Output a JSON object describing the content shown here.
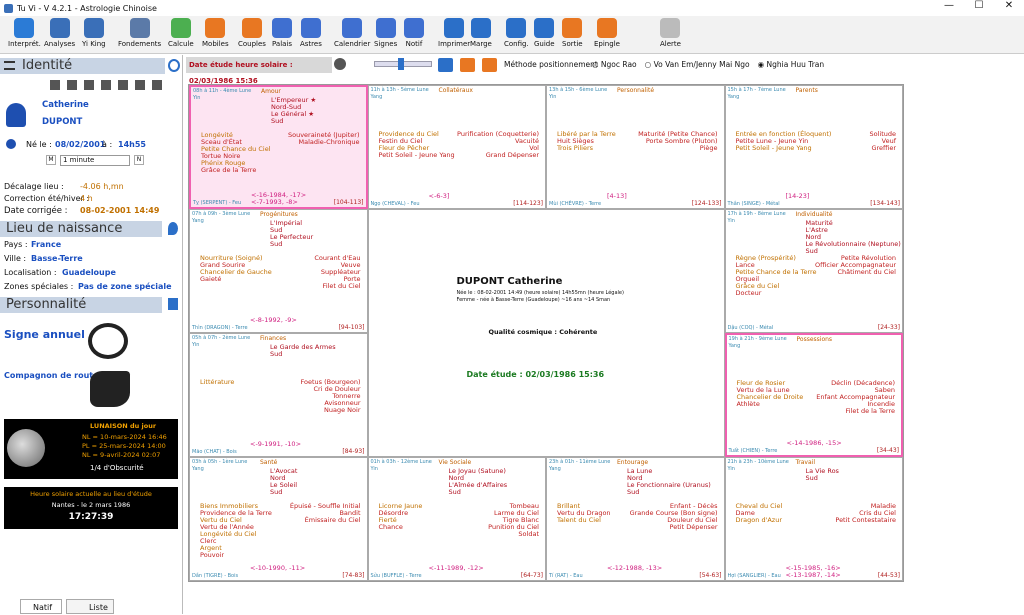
{
  "window": {
    "title": "Tu Vi - V 4.2.1 - Astrologie Chinoise",
    "min": "—",
    "max": "☐",
    "close": "✕"
  },
  "toolbar": [
    {
      "label": "Interprét.",
      "color": "#2b7bd6"
    },
    {
      "label": "Analyses",
      "color": "#3a6fb8"
    },
    {
      "label": "Yi King",
      "color": "#3a6fb8"
    },
    {
      "label": "Fondements",
      "color": "#5b7aa8"
    },
    {
      "label": "Calcule",
      "color": "#4caf50"
    },
    {
      "label": "Mobiles",
      "color": "#e87722"
    },
    {
      "label": "Couples",
      "color": "#e87722"
    },
    {
      "label": "Palais",
      "color": "#3f6fd0"
    },
    {
      "label": "Astres",
      "color": "#3f6fd0"
    },
    {
      "label": "Calendrier",
      "color": "#3f6fd0"
    },
    {
      "label": "Signes",
      "color": "#3f6fd0"
    },
    {
      "label": "Notif",
      "color": "#3f6fd0"
    },
    {
      "label": "Imprimer",
      "color": "#2b6fc8"
    },
    {
      "label": "Marge",
      "color": "#2b6fc8"
    },
    {
      "label": "Config.",
      "color": "#2b6fc8"
    },
    {
      "label": "Guide",
      "color": "#2b6fc8"
    },
    {
      "label": "Sortie",
      "color": "#e87722"
    },
    {
      "label": "Epingle",
      "color": "#e87722"
    },
    {
      "label": "Alerte",
      "color": "#bbbbbb"
    }
  ],
  "subbar": {
    "date_label": "Date étude heure solaire : 02/03/1986 15:36",
    "method_label": "Méthode positionnement",
    "options": [
      "Ngoc Rao",
      "Vo Van Em/Jenny Mai Ngo",
      "Nghia Huu Tran"
    ],
    "selected": 2
  },
  "identity": {
    "section": "Identité",
    "first_name": "Catherine",
    "last_name": "DUPONT",
    "born_label": "Né le :",
    "birth_date": "08/02/2001",
    "at_label": "à :",
    "birth_time": "14h55",
    "interval": "1 minute"
  },
  "corrections": {
    "lieu_label": "Décalage lieu :",
    "lieu_val": "-4.06 h,mn",
    "ete_label": "Correction été/hiver :",
    "ete_val": "4 h",
    "date_label": "Date corrigée :",
    "date_val": "08-02-2001  14:49"
  },
  "birthplace": {
    "section": "Lieu de naissance",
    "country_label": "Pays :",
    "country": "France",
    "city_label": "Ville :",
    "city": "Basse-Terre",
    "loc_label": "Localisation :",
    "loc": "Guadeloupe",
    "zones_label": "Zones spéciales :",
    "zones": "Pas de zone spéciale"
  },
  "personality": {
    "section": "Personnalité",
    "sign_label": "Signe annuel",
    "companion_label": "Compagnon de route"
  },
  "lunaison": {
    "title": "LUNAISON du jour",
    "nl": "NL = 10-mars-2024 16:46",
    "pl": "PL = 25-mars-2024 14:00",
    "nl2": "NL = 9-avril-2024 02:07",
    "obscurity": "1/4 d'Obscurité"
  },
  "solar": {
    "title": "Heure solaire actuelle au lieu d'étude",
    "place": "Nantes - le 2 mars 1986",
    "time": "17:27:39"
  },
  "tabs": {
    "natif": "Natif",
    "liste": "Liste"
  },
  "center": {
    "name": "DUPONT Catherine",
    "info1": "Née le : 08-02-2001  14:49 (heure solaire) 14h55mn (heure Légale)",
    "info2": "Femme - née à Basse-Terre (Guadeloupe) ~16 ans ~14 Sman",
    "quality": "Qualité cosmique : Cohérente",
    "date_etude": "Date étude : 02/03/1986 15:36"
  },
  "palaces": [
    {
      "id": "p1",
      "head": "08h à 11h - 4ème Lune",
      "yy": "Yin",
      "name": "Amour",
      "foot": "Tỵ (SERPENT) - Feu",
      "range": "[104-113]",
      "age": "<-16-1984, -17>",
      "age2": "<-7-1993, -8>",
      "left": [
        "Longévité",
        "Sceau d'État",
        "Petite Chance du Ciel",
        "Tortue Noire",
        "Phénix Rouge",
        "Grâce de la Terre"
      ],
      "right": [
        "Souveraineté (Jupiter)",
        "Maladie-Chronique"
      ],
      "stars": [
        "L'Empereur ★",
        "Nord-Sud",
        "Le Général ★",
        "Sud"
      ]
    },
    {
      "id": "p2",
      "head": "11h à 13h - 5ème Lune",
      "yy": "Yang",
      "name": "Collatéraux",
      "foot": "Ngọ (CHEVAL) - Feu",
      "range": "[114-123]",
      "age": "<-6-3]",
      "age2": "",
      "left": [
        "Providence du Ciel",
        "Festin du Ciel",
        "Fleur de Pêcher",
        "Petit Soleil - Jeune Yang"
      ],
      "right": [
        "Purification (Coquetterie)",
        "Vacuité",
        "Vol",
        "Grand Dépenser"
      ],
      "stars": []
    },
    {
      "id": "p3",
      "head": "13h à 15h - 6ème Lune",
      "yy": "Yin",
      "name": "Personnalité",
      "foot": "Mùi (CHÈVRE) - Terre",
      "range": "[124-133]",
      "age": "[4-13]",
      "age2": "",
      "left": [
        "Libéré par la Terre",
        "Huit Sièges",
        "Trois Piliers"
      ],
      "right": [
        "Maturité (Petite Chance)",
        "Porte Sombre (Pluton)",
        "Piège"
      ],
      "stars": []
    },
    {
      "id": "p4",
      "head": "15h à 17h - 7ème Lune",
      "yy": "Yang",
      "name": "Parents",
      "foot": "Thân (SINGE) - Métal",
      "range": "[134-143]",
      "age": "[14-23]",
      "age2": "",
      "left": [
        "Entrée en fonction (Éloquent)",
        "Petite Lune - Jeune Yin",
        "Petit Soleil - Jeune Yang"
      ],
      "right": [
        "Solitude",
        "Veuf",
        "Greffier"
      ],
      "stars": []
    },
    {
      "id": "p5",
      "head": "07h à 09h - 3ème Lune",
      "yy": "Yang",
      "name": "Progénitures",
      "foot": "Thìn (DRAGON) - Terre",
      "range": "[94-103]",
      "age": "<-8-1992, -9>",
      "age2": "",
      "left": [
        "Nourriture (Soigné)",
        "Grand Sourire",
        "Chancelier de Gauche",
        "Gaieté"
      ],
      "right": [
        "Courant d'Eau",
        "Veuve",
        "Suppléateur",
        "Porte",
        "Filet du Ciel"
      ],
      "stars": [
        "L'Impérial",
        "Sud",
        "Le Perfecteur",
        "Sud"
      ]
    },
    {
      "id": "p6",
      "head": "17h à 19h - 8ème Lune",
      "yy": "Yin",
      "name": "Individualité",
      "foot": "Dậu (COQ) - Métal",
      "range": "[24-33]",
      "age": "",
      "age2": "",
      "left": [
        "Règne (Prospérité)",
        "Lance",
        "Petite Chance de la Terre",
        "Orgueil",
        "Grâce du Ciel",
        "Docteur"
      ],
      "right": [
        "Petite Révolution",
        "Officier Accompagnateur",
        "Châtiment du Ciel"
      ],
      "stars": [
        "Maturité",
        "L'Astre",
        "Nord",
        "Le Révolutionnaire (Neptune)",
        "Sud"
      ]
    },
    {
      "id": "p7",
      "head": "05h à 07h - 2ème Lune",
      "yy": "Yin",
      "name": "Finances",
      "foot": "Mão (CHAT) - Bois",
      "range": "[84-93]",
      "age": "<-9-1991, -10>",
      "age2": "",
      "left": [
        "Littérature"
      ],
      "right": [
        "Foetus (Bourgeon)",
        "Cri de Douleur",
        "Tonnerre",
        "Avisonneur",
        "Nuage Noir"
      ],
      "stars": [
        "Le Garde des Armes",
        "Sud"
      ]
    },
    {
      "id": "p8",
      "head": "19h à 21h - 9ème Lune",
      "yy": "Yang",
      "name": "Possessions",
      "foot": "Tuất (CHIEN) - Terre",
      "range": "[34-43]",
      "age": "<-14-1986, -15>",
      "age2": "",
      "left": [
        "Fleur de Rosier",
        "Vertu de la Lune",
        "Chancelier de Droite",
        "Athlète"
      ],
      "right": [
        "Déclin (Décadence)",
        "Saben",
        "Enfant Accompagnateur",
        "Incendie",
        "Filet de la Terre"
      ],
      "stars": []
    },
    {
      "id": "p9",
      "head": "03h à 05h - 1ère Lune",
      "yy": "Yang",
      "name": "Santé",
      "foot": "Dần (TIGRE) - Bois",
      "range": "[74-83]",
      "age": "<-10-1990, -11>",
      "age2": "",
      "left": [
        "Biens Immobiliers",
        "Providence de la Terre",
        "Vertu du Ciel",
        "Vertu de l'Année",
        "Longévité du Ciel",
        "Clerc",
        "Argent",
        "Pouvoir"
      ],
      "right": [
        "Épuisé - Souffle Initial",
        "Bandit",
        "Émissaire du Ciel"
      ],
      "stars": [
        "L'Avocat",
        "Nord",
        "Le Soleil",
        "Sud"
      ]
    },
    {
      "id": "p10",
      "head": "01h à 03h - 12ème Lune",
      "yy": "Yin",
      "name": "Vie Sociale",
      "foot": "Sửu (BUFFLE) - Terre",
      "range": "[64-73]",
      "age": "<-11-1989, -12>",
      "age2": "",
      "left": [
        "Licorne Jaune",
        "Désordre",
        "Fierté",
        "Chance"
      ],
      "right": [
        "Tombeau",
        "Larme du Ciel",
        "Tigre Blanc",
        "Punition du Ciel",
        "Soldat"
      ],
      "stars": [
        "Le Joyau (Satune)",
        "Nord",
        "L'Aîmée d'Affaires",
        "Sud"
      ]
    },
    {
      "id": "p11",
      "head": "23h à 01h - 11ème Lune",
      "yy": "Yang",
      "name": "Entourage",
      "foot": "Tí (RAT) - Eau",
      "range": "[54-63]",
      "age": "<-12-1988, -13>",
      "age2": "",
      "left": [
        "Brillant",
        "Vertu du Dragon",
        "Talent du Ciel"
      ],
      "right": [
        "Enfant - Décès",
        "Grande Course (Bon signe)",
        "Douleur du Ciel",
        "Petit Dépenser"
      ],
      "stars": [
        "La Lune",
        "Nord",
        "Le Fonctionnaire (Uranus)",
        "Sud"
      ]
    },
    {
      "id": "p12",
      "head": "21h à 23h - 10ème Lune",
      "yy": "Yin",
      "name": "Travail",
      "foot": "Hợi (SANGLIER) - Eau",
      "range": "[44-53]",
      "age": "<-15-1985, -16>",
      "age2": "<-13-1987, -14>",
      "left": [
        "Cheval du Ciel",
        "Dame",
        "Dragon d'Azur"
      ],
      "right": [
        "Maladie",
        "Cris du Ciel",
        "Petit Contestataire"
      ],
      "stars": [
        "La Vie Ros",
        "Sud"
      ]
    }
  ]
}
